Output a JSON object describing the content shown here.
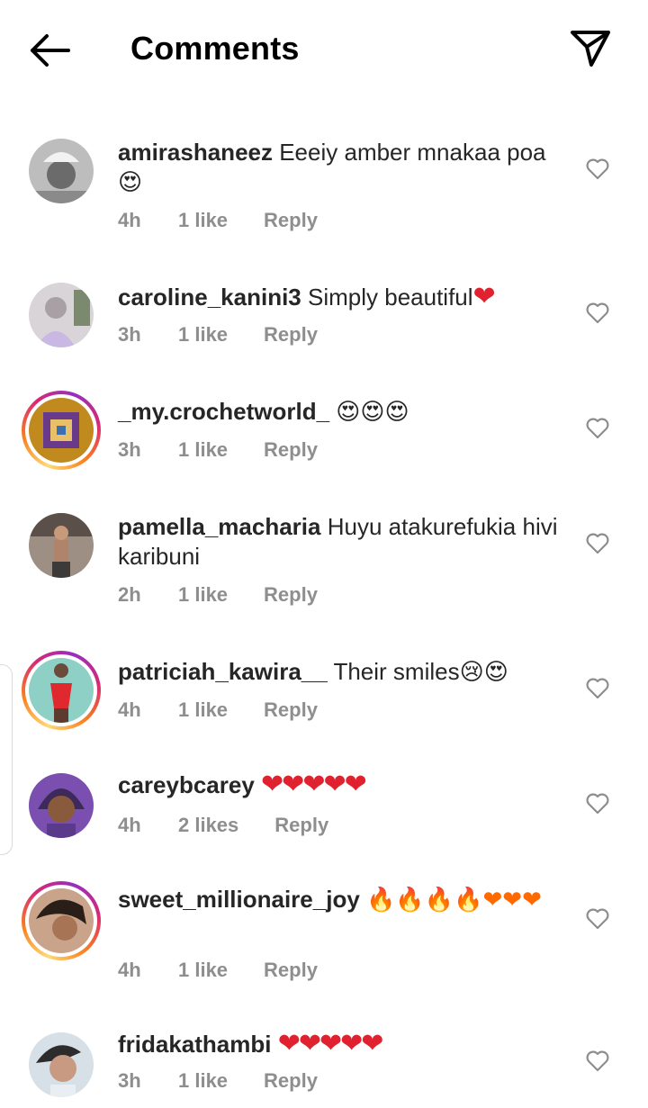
{
  "header": {
    "title": "Comments"
  },
  "comments": [
    {
      "username": "amirashaneez",
      "text": "Eeeiy amber mnakaa poa",
      "emoji": "😍",
      "time": "4h",
      "likes": "1 like",
      "reply": "Reply"
    },
    {
      "username": "caroline_kanini3",
      "text": "Simply beautiful",
      "emoji": "❤",
      "time": "3h",
      "likes": "1 like",
      "reply": "Reply"
    },
    {
      "username": "_my.crochetworld_",
      "text": "",
      "emoji": "😍😍😍",
      "time": "3h",
      "likes": "1 like",
      "reply": "Reply"
    },
    {
      "username": "pamella_macharia",
      "text": "Huyu atakurefukia hivi karibuni",
      "emoji": "",
      "time": "2h",
      "likes": "1 like",
      "reply": "Reply"
    },
    {
      "username": "patriciah_kawira__",
      "text": "Their smiles",
      "emoji": "😢😍",
      "time": "4h",
      "likes": "1 like",
      "reply": "Reply"
    },
    {
      "username": "careybcarey",
      "text": "",
      "emoji": "❤❤❤❤❤",
      "time": "4h",
      "likes": "2 likes",
      "reply": "Reply"
    },
    {
      "username": "sweet_millionaire_joy",
      "text": "",
      "emoji": "🔥🔥🔥🔥❤❤❤",
      "time": "4h",
      "likes": "1 like",
      "reply": "Reply"
    },
    {
      "username": "fridakathambi",
      "text": "",
      "emoji": "❤❤❤❤❤",
      "time": "3h",
      "likes": "1 like",
      "reply": "Reply"
    }
  ]
}
